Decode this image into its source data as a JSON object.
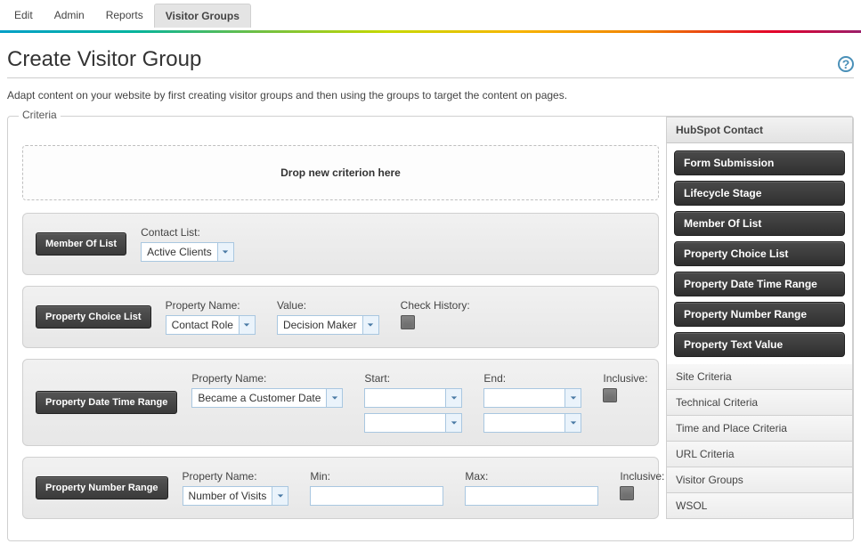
{
  "tabs": {
    "items": [
      "Edit",
      "Admin",
      "Reports",
      "Visitor Groups"
    ],
    "active_index": 3
  },
  "page_title": "Create Visitor Group",
  "hint": "Adapt content on your website by first creating visitor groups and then using the groups to target the content on pages.",
  "criteria_legend": "Criteria",
  "dropzone_text": "Drop new criterion here",
  "criteria": [
    {
      "badge": "Member Of List",
      "fields": [
        {
          "label": "Contact List:",
          "kind": "combo",
          "value": "Active Clients"
        }
      ]
    },
    {
      "badge": "Property Choice List",
      "fields": [
        {
          "label": "Property Name:",
          "kind": "combo",
          "value": "Contact Role"
        },
        {
          "label": "Value:",
          "kind": "combo",
          "value": "Decision Maker"
        },
        {
          "label": "Check History:",
          "kind": "check"
        }
      ]
    },
    {
      "badge": "Property Date Time Range",
      "fields": [
        {
          "label": "Property Name:",
          "kind": "combo",
          "value": "Became a Customer Date"
        },
        {
          "label": "Start:",
          "kind": "combo2",
          "value": ""
        },
        {
          "label": "End:",
          "kind": "combo2",
          "value": ""
        },
        {
          "label": "Inclusive:",
          "kind": "check"
        }
      ]
    },
    {
      "badge": "Property Number Range",
      "fields": [
        {
          "label": "Property Name:",
          "kind": "combo",
          "value": "Number of Visits"
        },
        {
          "label": "Min:",
          "kind": "input",
          "value": ""
        },
        {
          "label": "Max:",
          "kind": "input",
          "value": ""
        },
        {
          "label": "Inclusive:",
          "kind": "check"
        }
      ]
    }
  ],
  "side": {
    "header": "HubSpot Contact",
    "pills": [
      "Form Submission",
      "Lifecycle Stage",
      "Member Of List",
      "Property Choice List",
      "Property Date Time Range",
      "Property Number Range",
      "Property Text Value"
    ],
    "categories": [
      "Site Criteria",
      "Technical Criteria",
      "Time and Place Criteria",
      "URL Criteria",
      "Visitor Groups",
      "WSOL"
    ]
  }
}
